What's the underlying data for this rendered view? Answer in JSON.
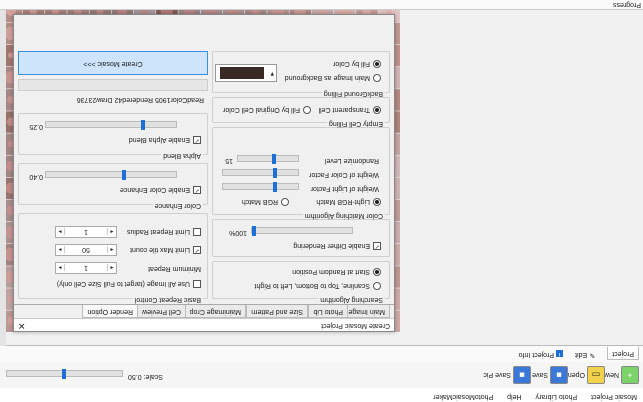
{
  "menu": [
    "Mosaic Project",
    "Photo Library",
    "Help",
    "PhotoMosaicMaker"
  ],
  "toolbar": {
    "new_label": "New",
    "open_label": "Open",
    "save_label": "Save",
    "save_pic_label": "Save Pic",
    "scale_label": "Scale: 0.50",
    "scale_value": 0.5
  },
  "tabs": {
    "project": "Project",
    "edit": "Edit",
    "project_info": "Project Info",
    "progress": "Progress"
  },
  "dialog": {
    "title": "Create Mosaic Project",
    "tabs": [
      "Main Image",
      "Photo Lib",
      "Size and Pattern",
      "Mainimage Crop",
      "Cell Preview",
      "Render Option"
    ],
    "searching": {
      "title": "Searching Algorithm",
      "opt1": "Scanline, Top to Bottom, Left to Right",
      "opt2": "Start at Random Position"
    },
    "dither": {
      "label": "Enable Dither Rendering",
      "value": "100%",
      "fraction": 1.0
    },
    "color_match": {
      "title": "Color Matching Algorithm",
      "opt1": "Light-RGB Match",
      "opt2": "RGB Match",
      "light_factor": "Weight of Light Factor",
      "color_factor": "Weight of Color Factor",
      "randomize": "Randomize Level",
      "randomize_value": "15",
      "light_fraction": 0.3,
      "color_fraction": 0.3,
      "randomize_fraction": 0.4
    },
    "empty_fill": {
      "title": "Empty Cell Filling",
      "opt1": "Transparent Cell",
      "opt2": "Fill by Original Cell Color"
    },
    "bg_fill": {
      "title": "BackGround Filling",
      "opt1": "Main Image as Background",
      "opt2": "Fill by Color",
      "color": "#3a2a25"
    },
    "basic_repeat": {
      "title": "Basic Repeat Control",
      "use_all": "Use All Image (target to Full Size Cell only)",
      "min_repeat": "Minimum Repeat",
      "min_repeat_value": "1",
      "max_tile": "Limit Max tile count",
      "max_tile_value": "50",
      "repeat_radius": "Limit Repeat Radius",
      "repeat_radius_value": "1"
    },
    "color_enhance": {
      "title": "Color Enhance",
      "label": "Enable Color Enhance",
      "value": "0.40",
      "fraction": 0.4
    },
    "alpha_blend": {
      "title": "Alpha Blend",
      "label": "Enable Alpha Blend",
      "value": "0.25",
      "fraction": 0.25
    },
    "status": "ReadColor1905 Rendered42 Draw23736",
    "create_button": "Create Mosaic >>>"
  },
  "colors": {
    "accent": "#1e6fd6",
    "button_bg": "#cde4fb"
  }
}
